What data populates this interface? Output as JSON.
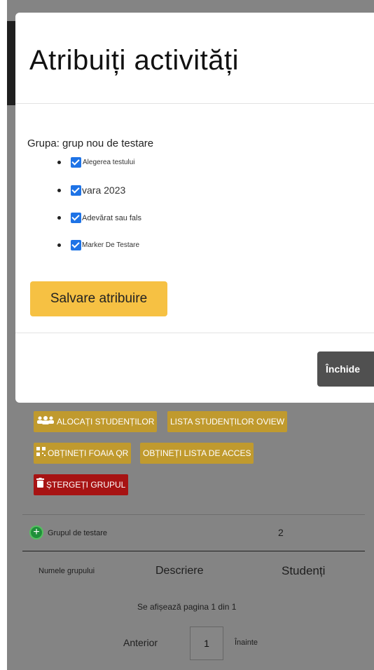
{
  "modal": {
    "title": "Atribuiți activități",
    "group_line": "Grupa: grup nou de testare",
    "activities": [
      {
        "label": "Alegerea testului",
        "checked": true
      },
      {
        "label": "vara 2023",
        "checked": true
      },
      {
        "label": "Adevărat sau fals",
        "checked": true
      },
      {
        "label": "Marker De Testare",
        "checked": true
      }
    ],
    "save_label": "Salvare atribuire",
    "close_label": "Închide"
  },
  "actions": {
    "allocate_label": "ALOCAȚI STUDENȚILOR",
    "student_list_label": "LISTA STUDENȚILOR OVIEW",
    "qr_label": "OBȚINEȚI FOAIA QR",
    "access_list_label": "OBȚINEȚI LISTA DE ACCES",
    "delete_label": "ȘTERGEȚI GRUPUL"
  },
  "group_row": {
    "name": "Grupul de testare",
    "students": "2"
  },
  "table": {
    "col_name": "Numele grupului",
    "col_description": "Descriere",
    "col_students": "Studenți"
  },
  "pagination": {
    "status": "Se afișează pagina 1 din 1",
    "prev": "Anterior",
    "page": "1",
    "next": "Înainte"
  },
  "colors": {
    "accent_gold": "#f6c143",
    "action_gold": "#c09a2e",
    "danger_red": "#a71313",
    "check_blue": "#1e73e6"
  }
}
